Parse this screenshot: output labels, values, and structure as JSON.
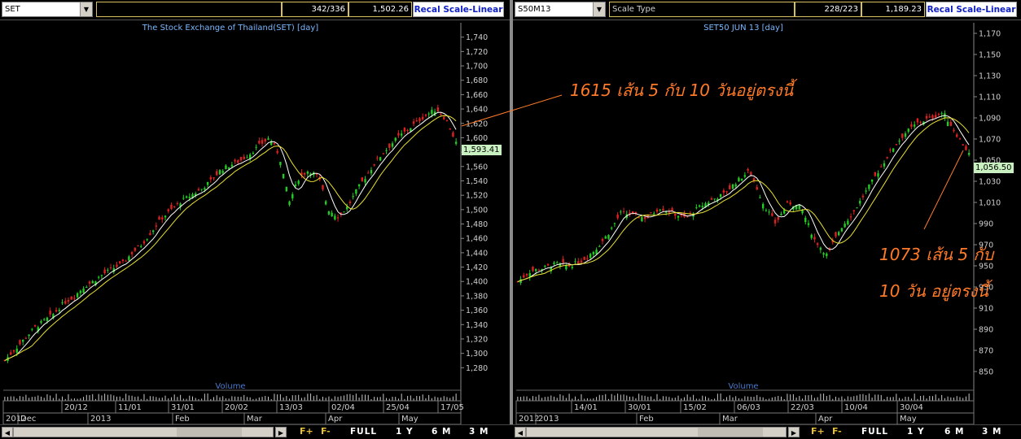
{
  "left_panel": {
    "symbol": "SET",
    "counter": "342/336",
    "last": "1,502.26",
    "recal_label": "Recal Scale-Linear",
    "chart_title": "The Stock Exchange of Thailand(SET) [day]",
    "volume_label": "Volume",
    "price_label": "1,593.41",
    "annotation": "1615 เส้น 5 กับ 10 วันอยู่ตรงนี้",
    "date_ticks": [
      "20/12",
      "11/01",
      "31/01",
      "20/02",
      "13/03",
      "02/04",
      "25/04",
      "17/05"
    ],
    "month_ticks": [
      "2012",
      "Dec",
      "2013",
      "Feb",
      "Mar",
      "Apr",
      "May"
    ],
    "y_ticks": [
      "1,740",
      "1,720",
      "1,700",
      "1,680",
      "1,660",
      "1,640",
      "1,620",
      "1,600",
      "1,580",
      "1,560",
      "1,540",
      "1,520",
      "1,500",
      "1,480",
      "1,460",
      "1,440",
      "1,420",
      "1,400",
      "1,380",
      "1,360",
      "1,340",
      "1,320",
      "1,300",
      "1,280"
    ]
  },
  "right_panel": {
    "symbol": "S50M13",
    "scale_type": "Scale Type",
    "counter": "228/223",
    "last": "1,189.23",
    "recal_label": "Recal Scale-Linear",
    "chart_title": "SET50 JUN 13  [day]",
    "volume_label": "Volume",
    "price_label": "1,056.50",
    "annotation_line1": "1073 เส้น 5 กับ",
    "annotation_line2": "10 วัน อยู่ตรงนี้",
    "date_ticks": [
      "14/01",
      "30/01",
      "15/02",
      "06/03",
      "22/03",
      "10/04",
      "30/04"
    ],
    "month_ticks": [
      "2012",
      "2013",
      "Feb",
      "Mar",
      "Apr",
      "May"
    ],
    "y_ticks": [
      "1,170",
      "1,150",
      "1,130",
      "1,110",
      "1,090",
      "1,070",
      "1,050",
      "1,030",
      "1,010",
      "990",
      "970",
      "950",
      "930",
      "910",
      "890",
      "870",
      "850"
    ]
  },
  "bottom_bar": {
    "f_plus": "F+",
    "f_minus": "F-",
    "full": "FULL",
    "one_year": "1 Y",
    "six_month": "6 M",
    "three_month": "3 M"
  },
  "colors": {
    "up": "#22cc22",
    "down": "#e02020",
    "ma5": "#ffffff",
    "ma10": "#e8e030",
    "annotation": "#ff7a28",
    "recal": "#1020c8"
  },
  "chart_data": [
    {
      "type": "candlestick",
      "title": "The Stock Exchange of Thailand(SET) [day]",
      "ylim": [
        1260,
        1760
      ],
      "close_path": [
        1290,
        1305,
        1320,
        1335,
        1345,
        1355,
        1370,
        1378,
        1392,
        1400,
        1410,
        1418,
        1425,
        1440,
        1452,
        1470,
        1488,
        1500,
        1512,
        1520,
        1528,
        1540,
        1555,
        1562,
        1568,
        1578,
        1590,
        1600,
        1575,
        1510,
        1545,
        1555,
        1545,
        1500,
        1490,
        1505,
        1530,
        1550,
        1570,
        1585,
        1600,
        1610,
        1622,
        1632,
        1640,
        1625,
        1593
      ]
    },
    {
      "type": "candlestick",
      "title": "SET50 JUN 13  [day]",
      "ylim": [
        840,
        1180
      ],
      "close_path": [
        935,
        945,
        948,
        952,
        950,
        955,
        965,
        980,
        1000,
        998,
        995,
        1005,
        1000,
        995,
        1005,
        1012,
        1018,
        1030,
        1040,
        1010,
        990,
        1010,
        1005,
        975,
        960,
        985,
        1000,
        1020,
        1040,
        1060,
        1075,
        1085,
        1090,
        1095,
        1075,
        1056
      ]
    }
  ]
}
